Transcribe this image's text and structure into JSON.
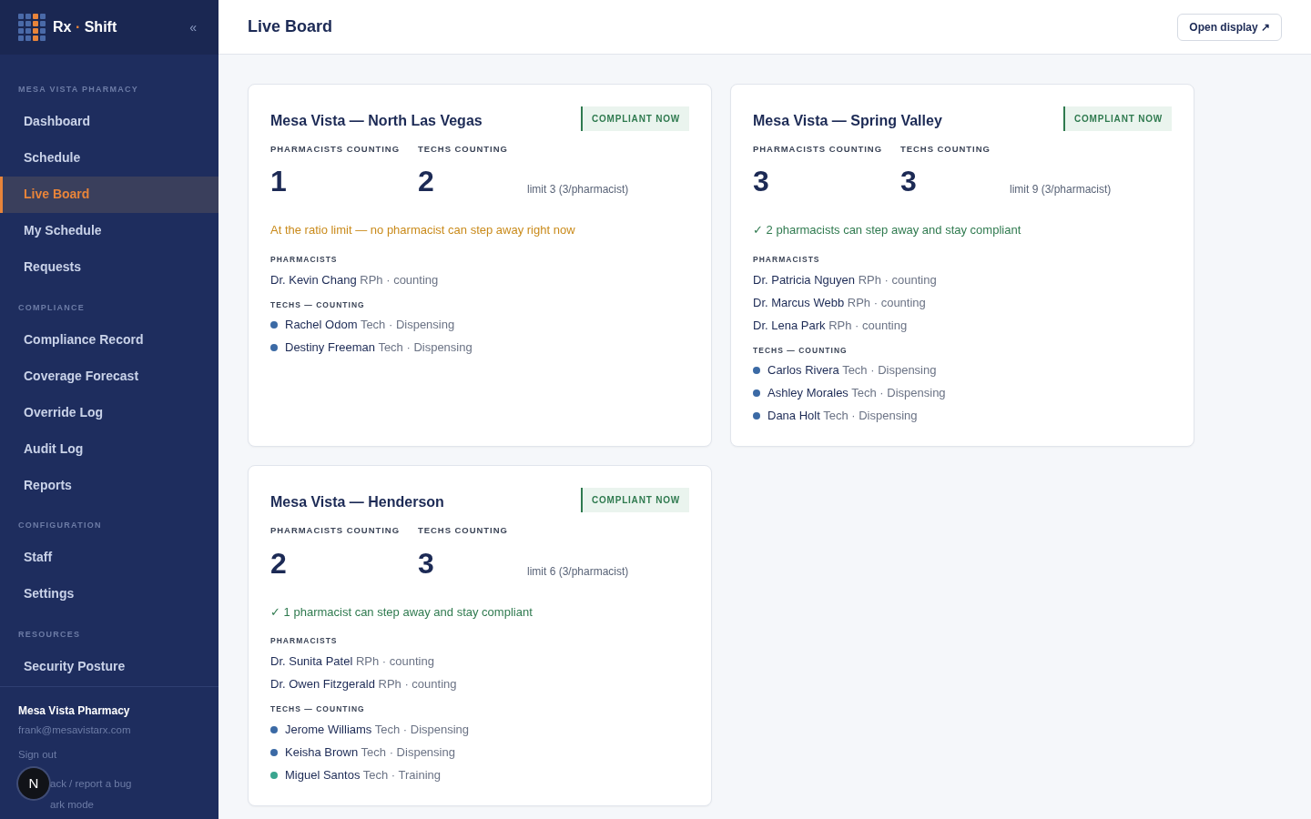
{
  "sidebar": {
    "brand": {
      "left": "Rx",
      "dot": "·",
      "right": "Shift"
    },
    "collapse": "«",
    "sections": [
      {
        "label": "MESA VISTA PHARMACY",
        "items": [
          {
            "label": "Dashboard",
            "selected": false
          },
          {
            "label": "Schedule",
            "selected": false
          },
          {
            "label": "Live Board",
            "selected": true
          },
          {
            "label": "My Schedule",
            "selected": false
          },
          {
            "label": "Requests",
            "selected": false
          }
        ]
      },
      {
        "label": "COMPLIANCE",
        "items": [
          {
            "label": "Compliance Record",
            "selected": false
          },
          {
            "label": "Coverage Forecast",
            "selected": false
          },
          {
            "label": "Override Log",
            "selected": false
          },
          {
            "label": "Audit Log",
            "selected": false
          },
          {
            "label": "Reports",
            "selected": false
          }
        ]
      },
      {
        "label": "CONFIGURATION",
        "items": [
          {
            "label": "Staff",
            "selected": false
          },
          {
            "label": "Settings",
            "selected": false
          }
        ]
      },
      {
        "label": "RESOURCES",
        "items": [
          {
            "label": "Security Posture",
            "selected": false
          }
        ]
      }
    ],
    "account": {
      "name": "Mesa Vista Pharmacy",
      "email": "frank@mesavistarx.com",
      "sign_out": "Sign out",
      "feedback": "ack / report a bug",
      "dark_mode": "ark mode",
      "badge": "N"
    }
  },
  "header": {
    "title": "Live Board",
    "button": "Open display ↗"
  },
  "stores": [
    {
      "name": "Mesa Vista — North Las Vegas",
      "status": "COMPLIANT NOW",
      "pharm_label": "PHARMACISTS COUNTING",
      "pharm_count": "1",
      "tech_label": "TECHS COUNTING",
      "tech_count": "2",
      "limit": "limit 3 (3/pharmacist)",
      "message": {
        "kind": "warning",
        "text": "At the ratio limit — no pharmacist can step away right now"
      },
      "pharmacists_label": "PHARMACISTS",
      "pharmacists": [
        {
          "name": "Dr. Kevin Chang",
          "detail": "RPh · counting"
        }
      ],
      "techs_label": "TECHS — COUNTING",
      "techs": [
        {
          "name": "Rachel Odom",
          "detail": "Tech · Dispensing",
          "color": "#3b6aa5"
        },
        {
          "name": "Destiny Freeman",
          "detail": "Tech · Dispensing",
          "color": "#3b6aa5"
        }
      ]
    },
    {
      "name": "Mesa Vista — Spring Valley",
      "status": "COMPLIANT NOW",
      "pharm_label": "PHARMACISTS COUNTING",
      "pharm_count": "3",
      "tech_label": "TECHS COUNTING",
      "tech_count": "3",
      "limit": "limit 9 (3/pharmacist)",
      "message": {
        "kind": "ok",
        "text": "✓ 2 pharmacists can step away and stay compliant"
      },
      "pharmacists_label": "PHARMACISTS",
      "pharmacists": [
        {
          "name": "Dr. Patricia Nguyen",
          "detail": "RPh · counting"
        },
        {
          "name": "Dr. Marcus Webb",
          "detail": "RPh · counting"
        },
        {
          "name": "Dr. Lena Park",
          "detail": "RPh · counting"
        }
      ],
      "techs_label": "TECHS — COUNTING",
      "techs": [
        {
          "name": "Carlos Rivera",
          "detail": "Tech · Dispensing",
          "color": "#3b6aa5"
        },
        {
          "name": "Ashley Morales",
          "detail": "Tech · Dispensing",
          "color": "#3b6aa5"
        },
        {
          "name": "Dana Holt",
          "detail": "Tech · Dispensing",
          "color": "#3b6aa5"
        }
      ]
    },
    {
      "name": "Mesa Vista — Henderson",
      "status": "COMPLIANT NOW",
      "pharm_label": "PHARMACISTS COUNTING",
      "pharm_count": "2",
      "tech_label": "TECHS COUNTING",
      "tech_count": "3",
      "limit": "limit 6 (3/pharmacist)",
      "message": {
        "kind": "ok",
        "text": "✓ 1 pharmacist can step away and stay compliant"
      },
      "pharmacists_label": "PHARMACISTS",
      "pharmacists": [
        {
          "name": "Dr. Sunita Patel",
          "detail": "RPh · counting"
        },
        {
          "name": "Dr. Owen Fitzgerald",
          "detail": "RPh · counting"
        }
      ],
      "techs_label": "TECHS — COUNTING",
      "techs": [
        {
          "name": "Jerome Williams",
          "detail": "Tech · Dispensing",
          "color": "#3b6aa5"
        },
        {
          "name": "Keisha Brown",
          "detail": "Tech · Dispensing",
          "color": "#3b6aa5"
        },
        {
          "name": "Miguel Santos",
          "detail": "Tech · Training",
          "color": "#3aa58f"
        }
      ]
    }
  ]
}
